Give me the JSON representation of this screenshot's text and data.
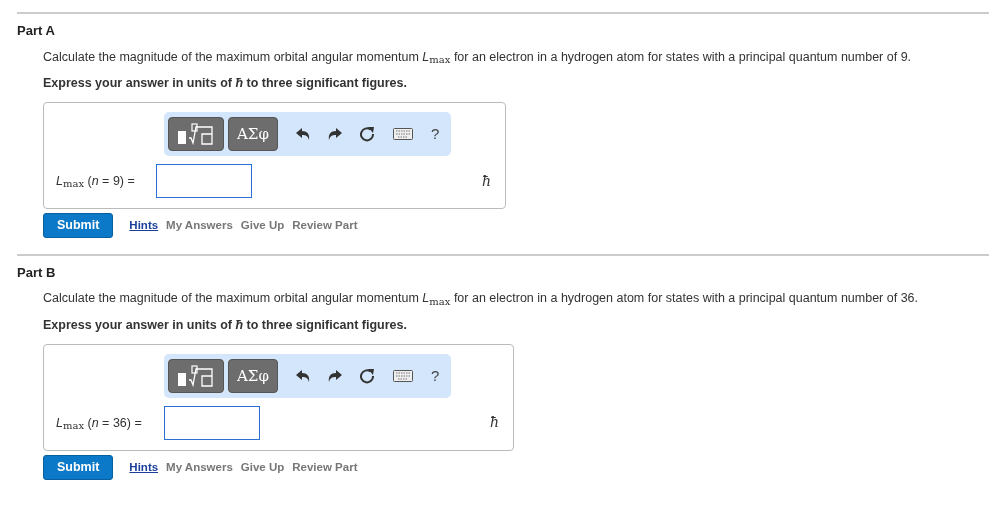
{
  "parts": [
    {
      "title": "Part A",
      "question": "Calculate the magnitude of the maximum orbital angular momentum *L*$_{max}$ for an electron in a hydrogen atom for states with a principal quantum number of 9.",
      "instruction": "Express your answer in units of *ħ* to three significant figures.",
      "toolbar": [
        {
          "kind": "templates"
        },
        {
          "kind": "symbols",
          "label": "ΑΣφ"
        },
        {
          "kind": "undo"
        },
        {
          "kind": "redo"
        },
        {
          "kind": "reset"
        },
        {
          "kind": "keyboard"
        },
        {
          "kind": "help",
          "label": "?"
        }
      ],
      "answer_label": "*L*$_{max}$ (*n* = 9) =",
      "unit": "ħ",
      "submit": "Submit",
      "links": [
        {
          "label": "Hints",
          "kind": "link"
        },
        {
          "label": "My Answers",
          "kind": "muted"
        },
        {
          "label": "Give Up",
          "kind": "muted"
        },
        {
          "label": "Review Part",
          "kind": "muted"
        }
      ]
    },
    {
      "title": "Part B",
      "question": "Calculate the magnitude of the maximum orbital angular momentum *L*$_{max}$ for an electron in a hydrogen atom for states with a principal quantum number of 36.",
      "instruction": "Express your answer in units of *ħ* to three significant figures.",
      "toolbar": [
        {
          "kind": "templates"
        },
        {
          "kind": "symbols",
          "label": "ΑΣφ"
        },
        {
          "kind": "undo"
        },
        {
          "kind": "redo"
        },
        {
          "kind": "reset"
        },
        {
          "kind": "keyboard"
        },
        {
          "kind": "help",
          "label": "?"
        }
      ],
      "answer_label": "*L*$_{max}$ (*n* = 36) =",
      "unit": "ħ",
      "submit": "Submit",
      "links": [
        {
          "label": "Hints",
          "kind": "link"
        },
        {
          "label": "My Answers",
          "kind": "muted"
        },
        {
          "label": "Give Up",
          "kind": "muted"
        },
        {
          "label": "Review Part",
          "kind": "muted"
        }
      ]
    }
  ]
}
